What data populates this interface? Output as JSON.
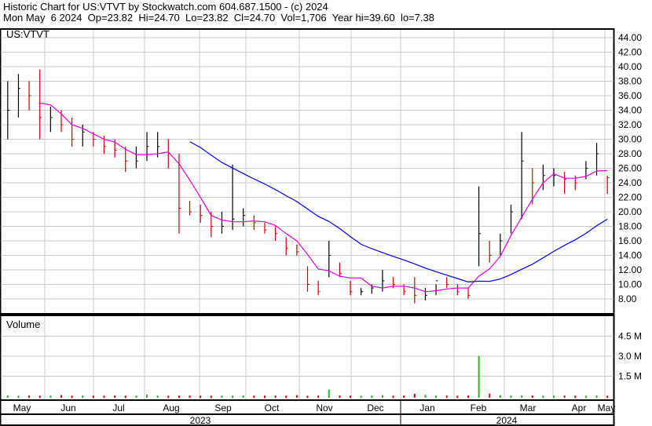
{
  "header": {
    "title": "Historic Chart for US:VTVT by Stockwatch.com 604.687.1500 - (c) 2024",
    "quote": "Mon May  6 2024  Op=23.82  Hi=24.70  Lo=23.82  Cl=24.70  Vol=1,706  Year hi=39.60  lo=7.38"
  },
  "chart_data": {
    "type": "line",
    "title": "US:VTVT",
    "volume_label": "Volume",
    "price_ticks": [
      "44.00",
      "42.00",
      "40.00",
      "38.00",
      "36.00",
      "34.00",
      "32.00",
      "30.00",
      "28.00",
      "26.00",
      "24.00",
      "22.00",
      "20.00",
      "18.00",
      "16.00",
      "14.00",
      "12.00",
      "10.00",
      "8.00"
    ],
    "price_ylim": [
      7,
      45
    ],
    "volume_ticks": [
      "4.5 M",
      "3.0 M",
      "1.5 M"
    ],
    "months": [
      "May",
      "Jun",
      "Jul",
      "Aug",
      "Sep",
      "Oct",
      "Nov",
      "Dec",
      "Jan",
      "Feb",
      "Mar",
      "Apr",
      "May"
    ],
    "years": [
      "2023",
      "2024"
    ],
    "colors": {
      "up": "#000000",
      "down": "#cc0000",
      "ma_short": "#e000e0",
      "ma_long": "#0000e0",
      "vol_up": "#22bb22",
      "vol_down": "#ee0000",
      "grid": "#c8c8c8"
    },
    "weekly": [
      [
        38,
        30,
        34
      ],
      [
        39,
        33,
        37
      ],
      [
        38,
        34,
        36
      ],
      [
        39.6,
        30,
        33
      ],
      [
        34.5,
        31,
        33
      ],
      [
        34,
        31,
        32
      ],
      [
        33,
        29,
        30
      ],
      [
        32,
        29,
        31
      ],
      [
        31,
        29,
        30
      ],
      [
        30.5,
        28,
        29
      ],
      [
        30,
        27.5,
        28.5
      ],
      [
        29,
        25.5,
        27
      ],
      [
        29,
        26,
        27
      ],
      [
        31,
        27,
        29
      ],
      [
        31,
        27.5,
        29
      ],
      [
        30,
        26,
        28
      ],
      [
        28,
        17,
        20.5
      ],
      [
        21.5,
        19.5,
        20
      ],
      [
        21,
        18.5,
        19.5
      ],
      [
        20,
        16.5,
        18
      ],
      [
        20,
        17,
        18
      ],
      [
        26.5,
        17.5,
        19
      ],
      [
        20.5,
        18,
        19.5
      ],
      [
        19.5,
        17.5,
        18.5
      ],
      [
        18.5,
        17,
        17.5
      ],
      [
        18,
        16,
        17
      ],
      [
        16.5,
        14,
        15
      ],
      [
        15.5,
        14,
        14.5
      ],
      [
        12.5,
        9,
        10
      ],
      [
        10.5,
        8.5,
        9
      ],
      [
        16,
        11,
        14
      ],
      [
        13,
        11,
        11.5
      ],
      [
        10.5,
        8.5,
        9
      ],
      [
        9.5,
        8.5,
        9
      ],
      [
        10,
        8.7,
        9.5
      ],
      [
        12,
        9,
        10.5
      ],
      [
        11,
        9.5,
        10
      ],
      [
        10,
        8.5,
        9
      ],
      [
        11,
        7.4,
        8.5
      ],
      [
        9.5,
        7.8,
        8.5
      ],
      [
        10,
        8.5,
        10.5
      ],
      [
        11,
        9.5,
        10
      ],
      [
        10,
        8.5,
        9
      ],
      [
        9.5,
        8,
        8.5
      ],
      [
        23.5,
        12.5,
        17
      ],
      [
        16,
        13,
        14
      ],
      [
        17,
        14,
        16
      ],
      [
        21,
        17,
        20
      ],
      [
        31,
        19,
        27
      ],
      [
        26,
        21,
        24
      ],
      [
        26.5,
        23,
        25
      ],
      [
        26,
        23.5,
        25
      ],
      [
        25.5,
        22.5,
        24.5
      ],
      [
        25,
        23,
        24
      ],
      [
        27,
        24.5,
        26
      ],
      [
        29.5,
        25,
        28
      ],
      [
        25,
        22.5,
        24.7
      ]
    ],
    "volume_millions": [
      0.05,
      0.04,
      0.05,
      0.04,
      0.05,
      0.08,
      0.04,
      0.05,
      0.04,
      0.04,
      0.05,
      0.04,
      0.05,
      0.12,
      0.05,
      0.04,
      0.04,
      0.05,
      0.04,
      0.04,
      0.05,
      0.04,
      0.05,
      0.04,
      0.04,
      0.05,
      0.04,
      0.08,
      0.04,
      0.05,
      0.5,
      0.05,
      0.04,
      0.04,
      0.05,
      0.08,
      0.04,
      0.05,
      0.18,
      0.1,
      0.04,
      0.05,
      0.04,
      0.05,
      3.0,
      0.2,
      0.08,
      0.05,
      0.06,
      0.05,
      0.04,
      0.04,
      0.05,
      0.04,
      0.04,
      0.05,
      0.04
    ]
  }
}
